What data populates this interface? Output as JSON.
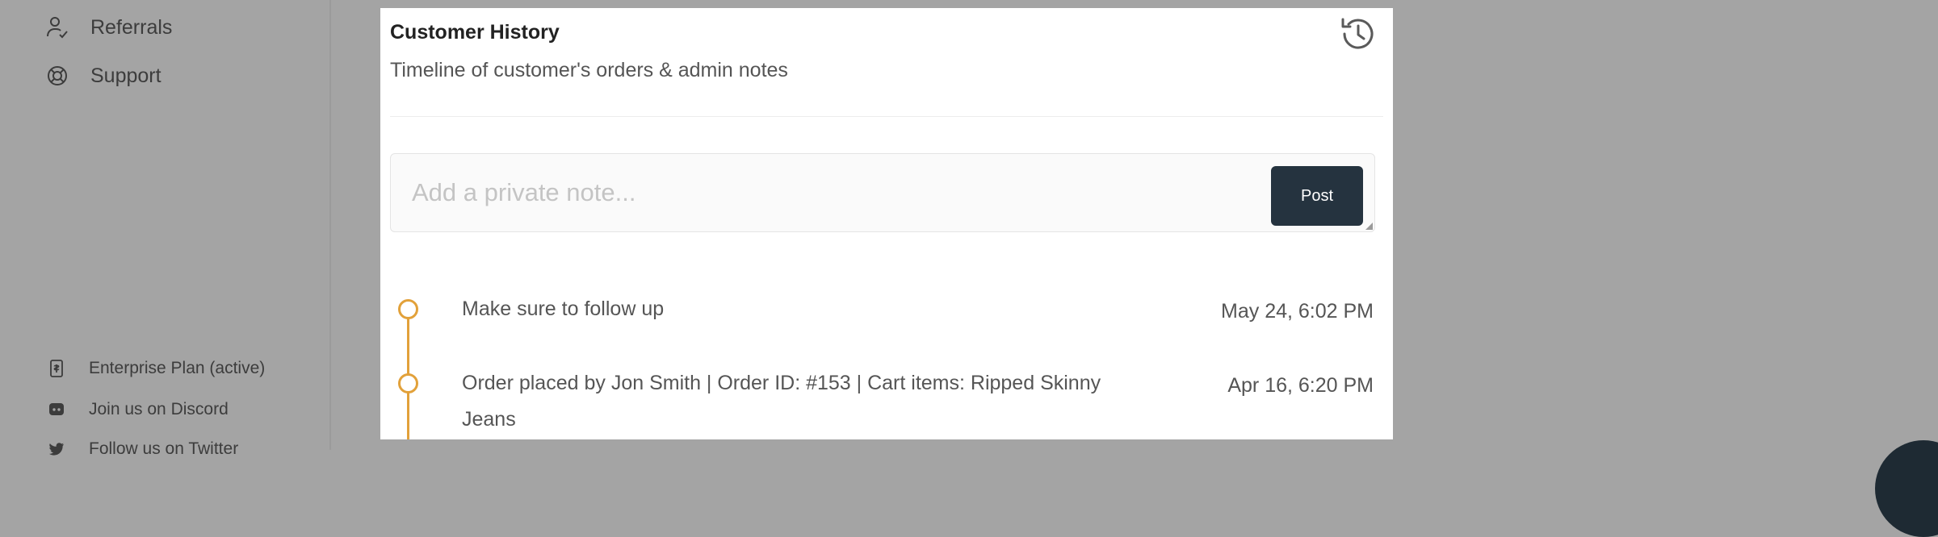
{
  "sidebar": {
    "nav": [
      {
        "label": "Referrals",
        "icon": "referrals-icon"
      },
      {
        "label": "Support",
        "icon": "support-icon"
      }
    ],
    "footer": [
      {
        "label": "Enterprise Plan (active)",
        "icon": "billing-icon"
      },
      {
        "label": "Join us on Discord",
        "icon": "discord-icon"
      },
      {
        "label": "Follow us on Twitter",
        "icon": "twitter-icon"
      }
    ]
  },
  "modal": {
    "title": "Customer History",
    "subtitle": "Timeline of customer's orders & admin notes",
    "icon": "history-icon",
    "note": {
      "placeholder": "Add a private note...",
      "value": "",
      "post_label": "Post"
    },
    "timeline": [
      {
        "text": "Make sure to follow up",
        "date": "May 24, 6:02 PM"
      },
      {
        "text": "Order placed by Jon Smith | Order ID: #153 | Cart items: Ripped Skinny Jeans",
        "date": "Apr 16, 6:20 PM"
      }
    ]
  },
  "colors": {
    "overlay": "#a4a4a4",
    "accent": "#e2a13a",
    "button": "#25333f"
  }
}
